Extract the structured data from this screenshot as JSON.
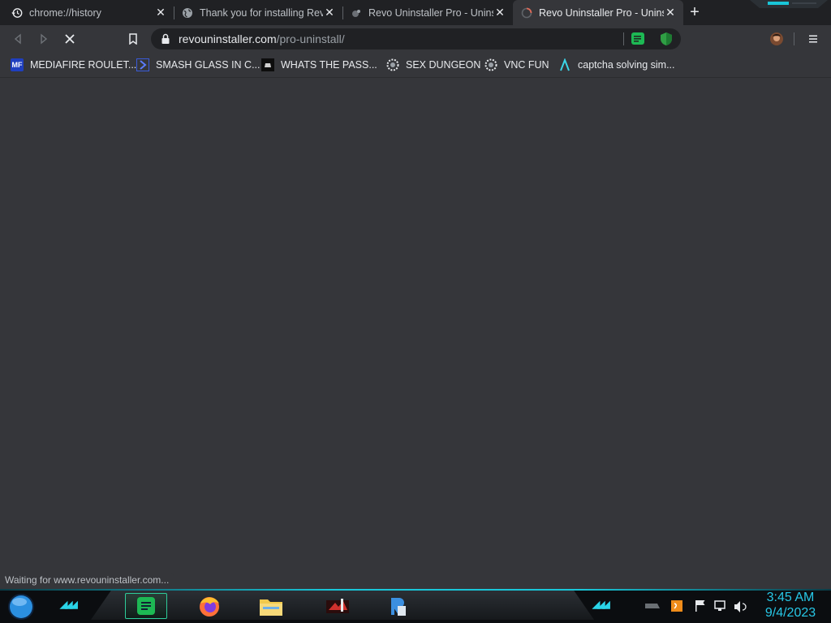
{
  "tabs": [
    {
      "title": "chrome://history",
      "icon": "history-icon",
      "active": false
    },
    {
      "title": "Thank you for installing Revo",
      "icon": "globe-icon",
      "active": false
    },
    {
      "title": "Revo Uninstaller Pro - Uninst",
      "icon": "revo-icon",
      "active": false
    },
    {
      "title": "Revo Uninstaller Pro - Uninst",
      "icon": "loading-spinner-icon",
      "active": true
    }
  ],
  "omnibox": {
    "host": "revouninstaller.com",
    "path": "/pro-uninstall/"
  },
  "bookmarks": [
    {
      "label": "MEDIAFIRE ROULET...",
      "icon_text": "MF",
      "icon": "mediafire-icon"
    },
    {
      "label": "SMASH GLASS IN C...",
      "icon": "chevron-icon"
    },
    {
      "label": "WHATS THE PASS...",
      "icon": "dark-square-icon"
    },
    {
      "label": "SEX DUNGEON",
      "icon": "gear-badge-icon"
    },
    {
      "label": "VNC FUN",
      "icon": "gear-badge-icon"
    },
    {
      "label": "captcha solving sim...",
      "icon": "lambda-icon"
    }
  ],
  "status_text": "Waiting for www.revouninstaller.com...",
  "clock": {
    "time": "3:45 AM",
    "date": "9/4/2023"
  },
  "colors": {
    "accent": "#19c6d8",
    "tab_bg": "#202124",
    "toolbar_bg": "#35363a",
    "spotify_green": "#1db954"
  }
}
